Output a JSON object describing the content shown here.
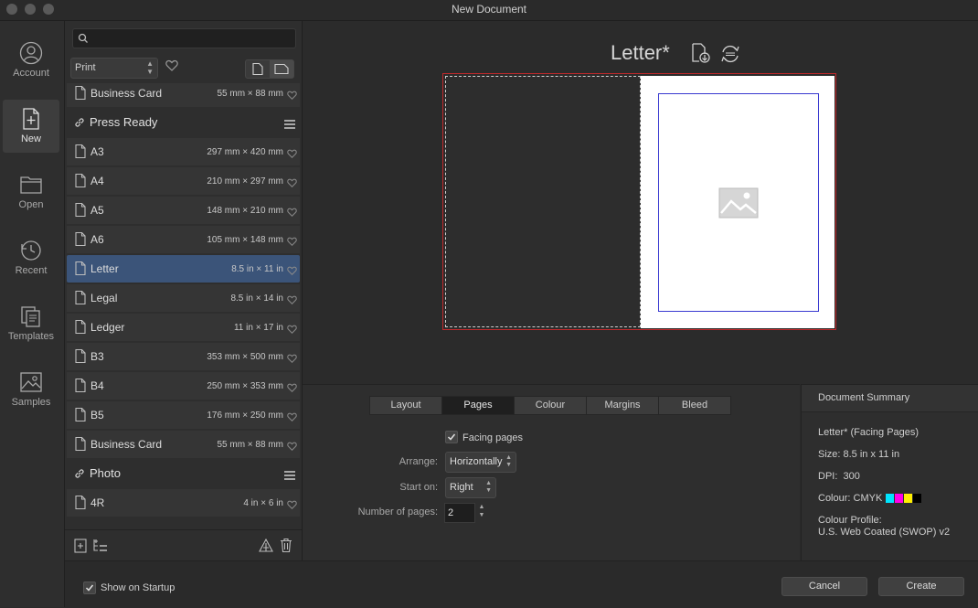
{
  "window": {
    "title": "New Document"
  },
  "nav": {
    "items": [
      {
        "label": "Account",
        "icon": "account-icon"
      },
      {
        "label": "New",
        "icon": "new-document-icon",
        "active": true
      },
      {
        "label": "Open",
        "icon": "folder-icon"
      },
      {
        "label": "Recent",
        "icon": "recent-clock-icon"
      },
      {
        "label": "Templates",
        "icon": "templates-icon"
      },
      {
        "label": "Samples",
        "icon": "samples-icon"
      }
    ]
  },
  "presets": {
    "search_placeholder": "",
    "filter_value": "Print",
    "rows": [
      {
        "type": "preset",
        "name": "Business Card",
        "size": "55 mm × 88 mm"
      },
      {
        "type": "category",
        "name": "Press Ready"
      },
      {
        "type": "preset",
        "name": "A3",
        "size": "297 mm × 420 mm"
      },
      {
        "type": "preset",
        "name": "A4",
        "size": "210 mm × 297 mm"
      },
      {
        "type": "preset",
        "name": "A5",
        "size": "148 mm × 210 mm"
      },
      {
        "type": "preset",
        "name": "A6",
        "size": "105 mm × 148 mm"
      },
      {
        "type": "preset",
        "name": "Letter",
        "size": "8.5 in × 11 in",
        "selected": true
      },
      {
        "type": "preset",
        "name": "Legal",
        "size": "8.5 in × 14 in"
      },
      {
        "type": "preset",
        "name": "Ledger",
        "size": "11 in × 17 in"
      },
      {
        "type": "preset",
        "name": "B3",
        "size": "353 mm × 500 mm"
      },
      {
        "type": "preset",
        "name": "B4",
        "size": "250 mm × 353 mm"
      },
      {
        "type": "preset",
        "name": "B5",
        "size": "176 mm × 250 mm"
      },
      {
        "type": "preset",
        "name": "Business Card",
        "size": "55 mm × 88 mm"
      },
      {
        "type": "category",
        "name": "Photo"
      },
      {
        "type": "preset",
        "name": "4R",
        "size": "4 in × 6 in"
      }
    ]
  },
  "preview": {
    "title": "Letter*"
  },
  "settings": {
    "tabs": [
      "Layout",
      "Pages",
      "Colour",
      "Margins",
      "Bleed"
    ],
    "active_tab": "Pages",
    "facing_pages_label": "Facing pages",
    "facing_pages_checked": true,
    "arrange_label": "Arrange:",
    "arrange_value": "Horizontally",
    "start_on_label": "Start on:",
    "start_on_value": "Right",
    "num_pages_label": "Number of pages:",
    "num_pages_value": "2"
  },
  "summary": {
    "header": "Document Summary",
    "doc": "Letter* (Facing Pages)",
    "size": "Size: 8.5 in x 11 in",
    "dpi": "DPI:  300",
    "colour": "Colour: CMYK",
    "cmyk_swatches": [
      "#00e5ff",
      "#ff00e6",
      "#ffef00",
      "#000000"
    ],
    "profile_label": "Colour Profile:",
    "profile_value": "U.S. Web Coated (SWOP) v2"
  },
  "bottom": {
    "show_on_startup": "Show on Startup",
    "show_on_startup_checked": true,
    "cancel": "Cancel",
    "create": "Create"
  },
  "colors": {
    "selection": "#3b5479",
    "bleed": "#c0292b",
    "margin_guide": "#3a3ad0"
  }
}
